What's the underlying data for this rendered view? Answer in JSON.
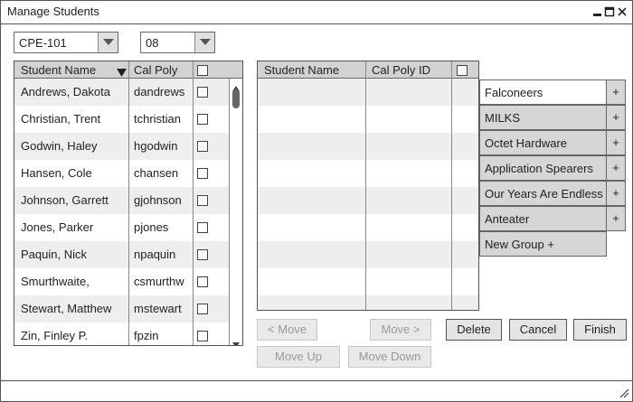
{
  "window": {
    "title": "Manage Students"
  },
  "filters": {
    "course": "CPE-101",
    "section": "08"
  },
  "left_table": {
    "columns": [
      "Student Name",
      "Cal Poly",
      ""
    ],
    "rows": [
      {
        "name": "Andrews, Dakota",
        "id": "dandrews"
      },
      {
        "name": "Christian, Trent",
        "id": "tchristian"
      },
      {
        "name": "Godwin, Haley",
        "id": "hgodwin"
      },
      {
        "name": "Hansen, Cole",
        "id": "chansen"
      },
      {
        "name": "Johnson, Garrett",
        "id": "gjohnson"
      },
      {
        "name": "Jones, Parker",
        "id": "pjones"
      },
      {
        "name": "Paquin, Nick",
        "id": "npaquin"
      },
      {
        "name": "Smurthwaite,",
        "id": "csmurthw"
      },
      {
        "name": "Stewart, Matthew",
        "id": "mstewart"
      },
      {
        "name": "Zin, Finley P.",
        "id": "fpzin"
      }
    ]
  },
  "right_table": {
    "columns": [
      "Student Name",
      "Cal Poly ID",
      ""
    ]
  },
  "groups": {
    "items": [
      {
        "label": "Falconeers",
        "plus": "+"
      },
      {
        "label": "MILKS",
        "plus": "+"
      },
      {
        "label": "Octet Hardware",
        "plus": "+"
      },
      {
        "label": "Application Spearers",
        "plus": "+"
      },
      {
        "label": "Our Years Are Endless",
        "plus": "+"
      },
      {
        "label": "Anteater",
        "plus": "+"
      }
    ],
    "new_group": "New Group +"
  },
  "buttons": {
    "move_left": "< Move",
    "move_right": "Move >",
    "delete": "Delete",
    "cancel": "Cancel",
    "finish": "Finish",
    "move_up": "Move Up",
    "move_down": "Move Down"
  },
  "icons": [
    "minimize-icon",
    "maximize-icon",
    "close-icon",
    "dropdown-arrow-icon",
    "sort-desc-icon",
    "scroll-up-icon",
    "scroll-down-icon",
    "resize-grip-icon"
  ]
}
